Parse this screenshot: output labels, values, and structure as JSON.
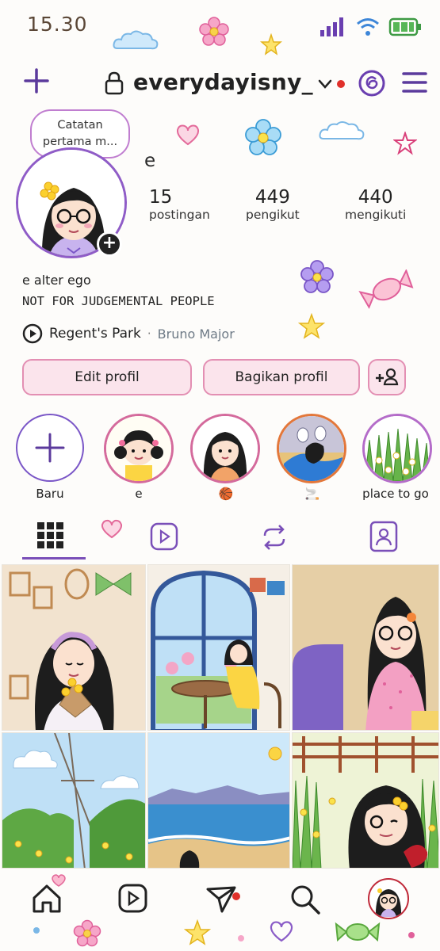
{
  "status_bar": {
    "time": "15.30",
    "icons": [
      "signal-icon",
      "wifi-icon",
      "battery-icon"
    ]
  },
  "header": {
    "username": "everydayisny_",
    "icons": [
      "add-icon",
      "chevron-down-icon",
      "threads-icon",
      "menu-icon"
    ]
  },
  "profile": {
    "note": "Catatan pertama m...",
    "note_line1": "Catatan",
    "note_line2": "pertama m...",
    "name": "e",
    "stats": [
      {
        "value": "15",
        "label": "postingan"
      },
      {
        "value": "449",
        "label": "pengikut"
      },
      {
        "value": "440",
        "label": "mengikuti"
      }
    ],
    "bio_line1": "e alter ego",
    "bio_line2": "NOT FOR JUDGEMENTAL PEOPLE",
    "music_title": "Regent's Park",
    "music_separator": "·",
    "music_artist": "Bruno Major"
  },
  "buttons": {
    "edit": "Edit profil",
    "share": "Bagikan profil"
  },
  "highlights": [
    {
      "label": "Baru"
    },
    {
      "label": "e"
    },
    {
      "label": "🏀"
    },
    {
      "label": "🚬"
    },
    {
      "label": "place to go"
    }
  ],
  "tabs": [
    "grid-icon",
    "reels-icon",
    "repost-icon",
    "tagged-icon"
  ],
  "bottom_nav": [
    "home-icon",
    "reels-icon",
    "send-icon",
    "search-icon",
    "profile-avatar"
  ],
  "colors": {
    "accent_purple": "#7a4fb8",
    "pink_button": "#fbe4ec",
    "pink_border": "#e38fb3",
    "tab_active": "#7a4fb8"
  }
}
